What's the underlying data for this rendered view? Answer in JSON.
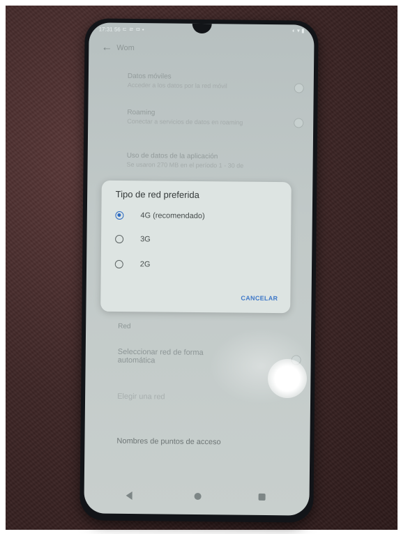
{
  "status_bar": {
    "time": "17:31 56 ㄷ ㄹ ㅁ •",
    "right": "◐ ▾ ▮"
  },
  "top_bar": {
    "back_icon": "arrow-back-icon",
    "title": "Wom"
  },
  "settings": [
    {
      "title": "Datos móviles",
      "subtitle": "Acceder a los datos por la red móvil",
      "value": ""
    },
    {
      "title": "Roaming",
      "subtitle": "Conectar a servicios de datos en roaming",
      "value": ""
    },
    {
      "title": "Uso de datos de la aplicación",
      "subtitle": "Se usaron 270 MB en el período 1 - 30 de",
      "value": ""
    }
  ],
  "background_rows": {
    "section_header": "Red",
    "auto_select_line1": "Seleccionar red de forma",
    "auto_select_line2": "automática",
    "choose_network": "Elegir una red",
    "apn": "Nombres de puntos de acceso"
  },
  "dialog": {
    "title": "Tipo de red preferida",
    "options": [
      {
        "label": "4G (recomendado)",
        "selected": true
      },
      {
        "label": "3G",
        "selected": false
      },
      {
        "label": "2G",
        "selected": false
      }
    ],
    "cancel_label": "CANCELAR"
  },
  "nav_bar": {
    "back_icon": "nav-back-icon",
    "home_icon": "nav-home-icon",
    "recents_icon": "nav-recents-icon"
  },
  "colors": {
    "accent": "#2d6bc2",
    "dialog_bg": "#dde4e2",
    "screen_bg": "#c1c9c8"
  }
}
